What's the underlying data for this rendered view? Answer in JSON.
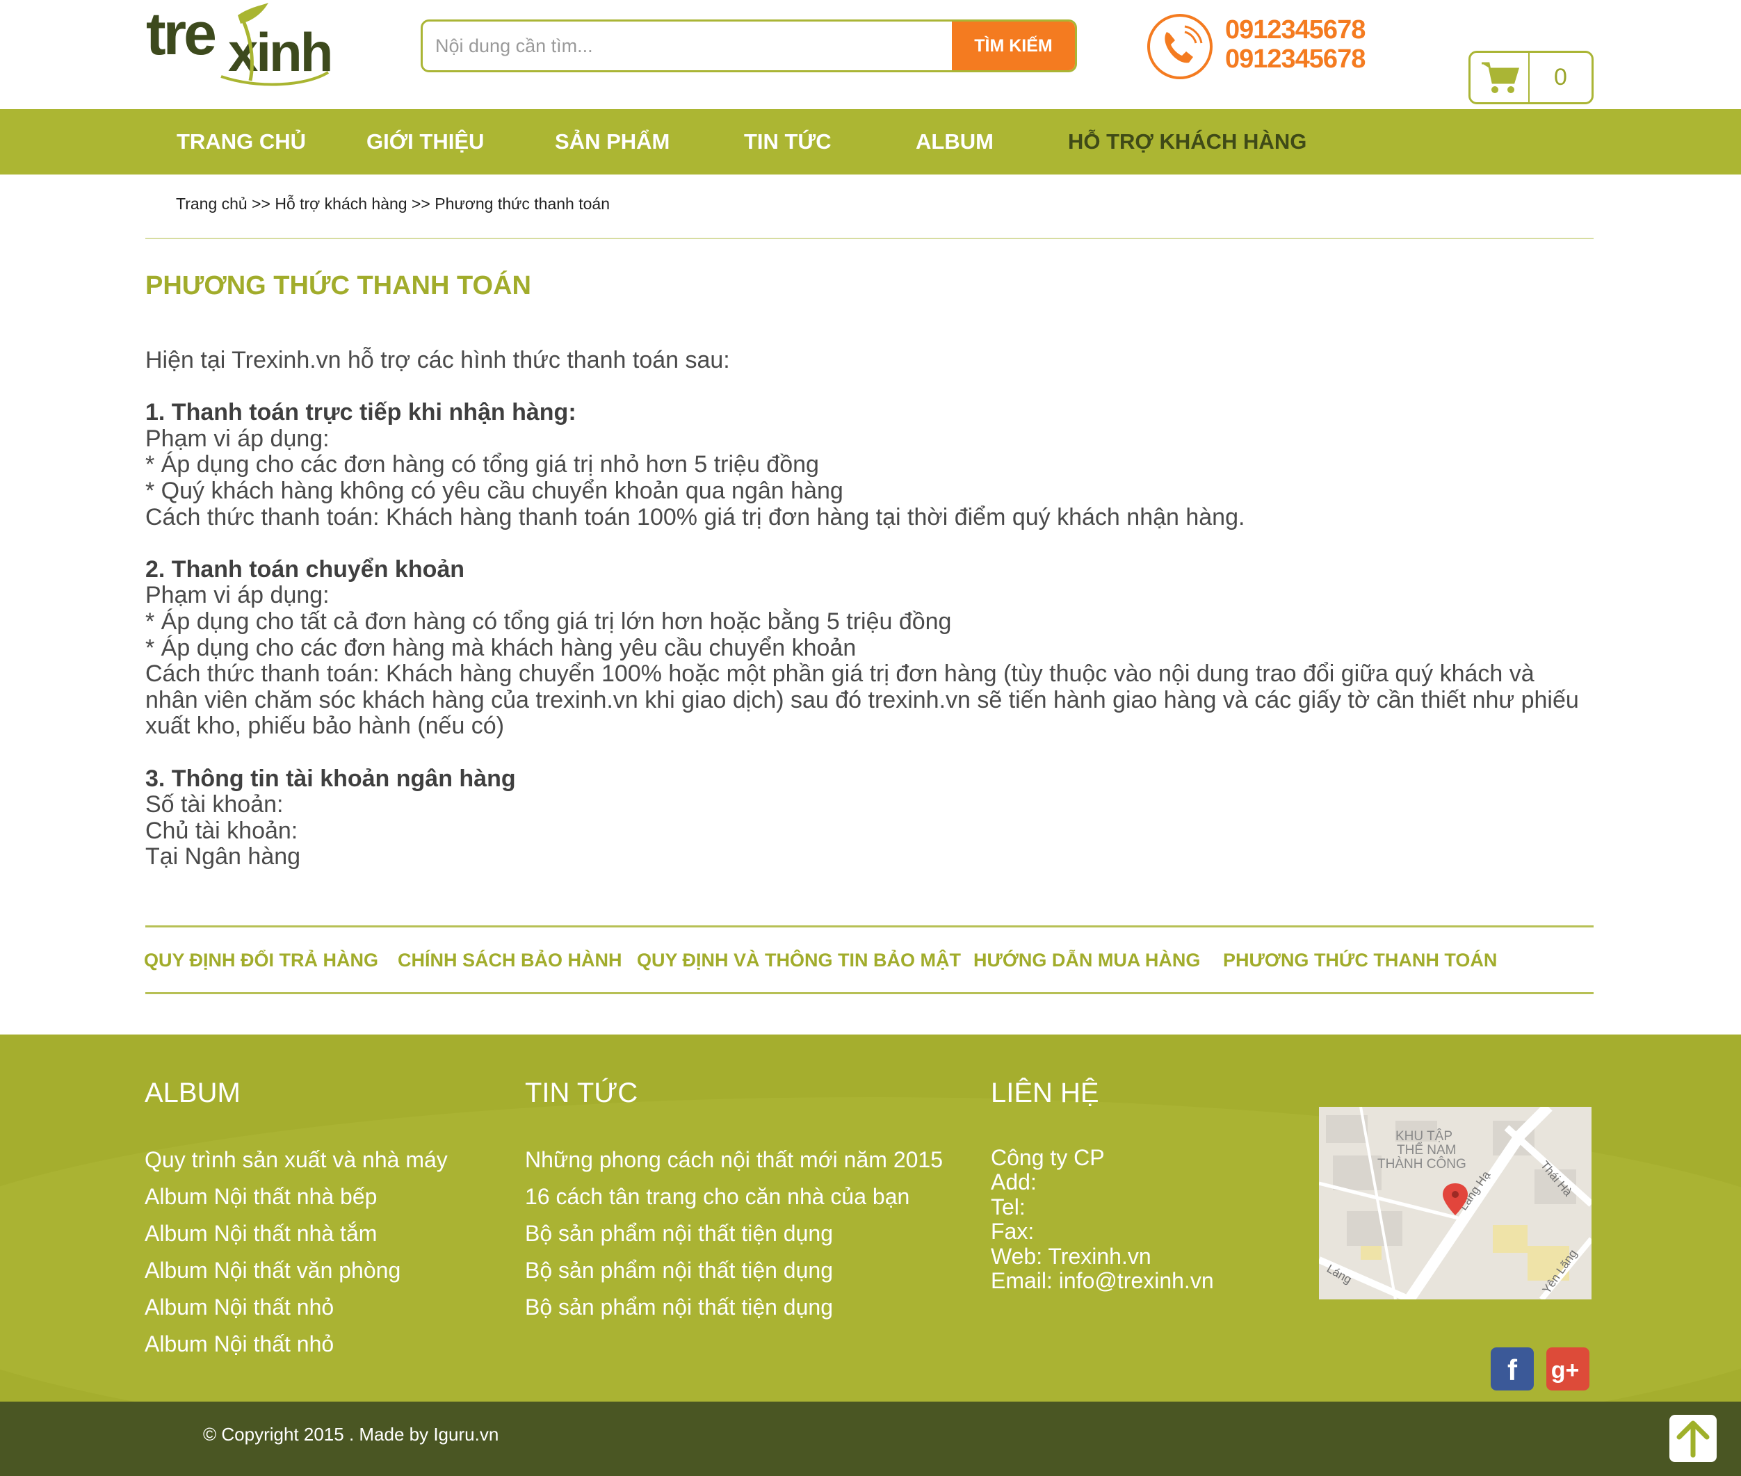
{
  "brand": {
    "logo_text": "trexinh",
    "accent_color": "#acb633",
    "orange": "#f47b20"
  },
  "search": {
    "placeholder": "Nội dung cần tìm...",
    "button_label": "TÌM KIẾM"
  },
  "hotline": {
    "phone_1": "0912345678",
    "phone_2": "0912345678"
  },
  "cart": {
    "count": "0"
  },
  "nav": {
    "items": [
      {
        "label": "TRANG CHỦ"
      },
      {
        "label": "GIỚI THIỆU"
      },
      {
        "label": "SẢN PHẨM"
      },
      {
        "label": "TIN TỨC"
      },
      {
        "label": "ALBUM"
      },
      {
        "label": "HỖ TRỢ KHÁCH HÀNG"
      }
    ]
  },
  "breadcrumb": {
    "text": "Trang chủ >> Hỗ trợ khách hàng >> Phương thức thanh toán"
  },
  "page": {
    "title": "PHƯƠNG THỨC THANH TOÁN",
    "intro": "Hiện tại Trexinh.vn hỗ trợ các hình thức thanh toán sau:",
    "s1_heading": "1. Thanh toán trực tiếp khi nhận hàng:",
    "s1_scope": "Phạm vi áp dụng:",
    "s1_b1": "* Áp dụng cho các đơn hàng có tổng giá trị nhỏ hơn  5 triệu đồng",
    "s1_b2": "* Quý khách hàng không có yêu cầu chuyển khoản qua ngân hàng",
    "s1_method": "Cách thức thanh toán: Khách hàng thanh toán 100% giá trị đơn hàng tại thời điểm quý khách nhận hàng.",
    "s2_heading": "2. Thanh toán chuyển khoản",
    "s2_scope": "Phạm vi áp dụng:",
    "s2_b1": "* Áp dụng cho tất cả đơn hàng có tổng giá trị lớn hơn hoặc bằng 5 triệu đồng",
    "s2_b2": "* Áp dụng cho các đơn hàng mà khách hàng yêu cầu chuyển khoản",
    "s2_method": "Cách thức thanh toán: Khách hàng chuyển 100% hoặc một phần giá trị đơn hàng (tùy thuộc vào nội dung trao đổi giữa quý khách và nhân viên chăm sóc khách hàng của trexinh.vn khi giao dịch) sau đó trexinh.vn sẽ tiến hành giao hàng và các giấy tờ cần thiết như phiếu xuất kho, phiếu bảo hành (nếu có)",
    "s3_heading": "3. Thông tin tài khoản ngân hàng",
    "s3_account_no": "Số tài khoản:",
    "s3_account_owner": "Chủ tài khoản:",
    "s3_bank": "Tại Ngân hàng"
  },
  "policy_links": [
    {
      "label": "QUY ĐỊNH ĐỔI TRẢ HÀNG"
    },
    {
      "label": "CHÍNH SÁCH BẢO HÀNH"
    },
    {
      "label": "QUY ĐỊNH VÀ THÔNG TIN BẢO MẬT"
    },
    {
      "label": "HƯỚNG DẪN MUA HÀNG"
    },
    {
      "label": "PHƯƠNG THỨC THANH TOÁN"
    }
  ],
  "footer": {
    "album": {
      "heading": "ALBUM",
      "links": [
        "Quy trình sản xuất và nhà máy",
        "Album Nội thất nhà bếp",
        "Album Nội thất nhà tắm",
        "Album Nội thất văn phòng",
        "Album Nội thất nhỏ",
        "Album Nội thất nhỏ"
      ]
    },
    "news": {
      "heading": "TIN TỨC",
      "links": [
        "Những phong cách nội thất mới năm 2015",
        "16 cách tân trang cho căn nhà của bạn",
        "Bộ sản phẩm nội thất tiện dụng",
        "Bộ sản phẩm nội thất tiện dụng",
        "Bộ sản phẩm nội thất tiện dụng"
      ]
    },
    "contact": {
      "heading": "LIÊN HỆ",
      "company": "Công ty CP",
      "add": "Add:",
      "tel": "Tel:",
      "fax": "Fax:",
      "web": "Web: Trexinh.vn",
      "email": "Email: info@trexinh.vn"
    },
    "map": {
      "label_1": "KHU TẬP",
      "label_2": "THỂ NAM",
      "label_3": "THÀNH CÔNG",
      "street_1": "Láng Hạ",
      "street_2": "Thái Hà",
      "street_3": "Láng",
      "street_4": "Yên Lãng"
    },
    "social": {
      "facebook": "f",
      "gplus": "g+"
    },
    "copyright": "© Copyright 2015  .  Made by Iguru.vn"
  }
}
